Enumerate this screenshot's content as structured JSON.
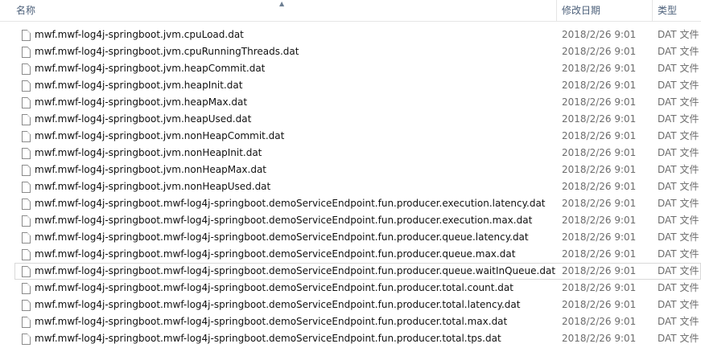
{
  "columns": {
    "name": "名称",
    "date": "修改日期",
    "type": "类型"
  },
  "files": [
    {
      "name": "mwf.mwf-log4j-springboot.jvm.cpuLoad.dat",
      "date": "2018/2/26 9:01",
      "type": "DAT 文件"
    },
    {
      "name": "mwf.mwf-log4j-springboot.jvm.cpuRunningThreads.dat",
      "date": "2018/2/26 9:01",
      "type": "DAT 文件"
    },
    {
      "name": "mwf.mwf-log4j-springboot.jvm.heapCommit.dat",
      "date": "2018/2/26 9:01",
      "type": "DAT 文件"
    },
    {
      "name": "mwf.mwf-log4j-springboot.jvm.heapInit.dat",
      "date": "2018/2/26 9:01",
      "type": "DAT 文件"
    },
    {
      "name": "mwf.mwf-log4j-springboot.jvm.heapMax.dat",
      "date": "2018/2/26 9:01",
      "type": "DAT 文件"
    },
    {
      "name": "mwf.mwf-log4j-springboot.jvm.heapUsed.dat",
      "date": "2018/2/26 9:01",
      "type": "DAT 文件"
    },
    {
      "name": "mwf.mwf-log4j-springboot.jvm.nonHeapCommit.dat",
      "date": "2018/2/26 9:01",
      "type": "DAT 文件"
    },
    {
      "name": "mwf.mwf-log4j-springboot.jvm.nonHeapInit.dat",
      "date": "2018/2/26 9:01",
      "type": "DAT 文件"
    },
    {
      "name": "mwf.mwf-log4j-springboot.jvm.nonHeapMax.dat",
      "date": "2018/2/26 9:01",
      "type": "DAT 文件"
    },
    {
      "name": "mwf.mwf-log4j-springboot.jvm.nonHeapUsed.dat",
      "date": "2018/2/26 9:01",
      "type": "DAT 文件"
    },
    {
      "name": "mwf.mwf-log4j-springboot.mwf-log4j-springboot.demoServiceEndpoint.fun.producer.execution.latency.dat",
      "date": "2018/2/26 9:01",
      "type": "DAT 文件"
    },
    {
      "name": "mwf.mwf-log4j-springboot.mwf-log4j-springboot.demoServiceEndpoint.fun.producer.execution.max.dat",
      "date": "2018/2/26 9:01",
      "type": "DAT 文件"
    },
    {
      "name": "mwf.mwf-log4j-springboot.mwf-log4j-springboot.demoServiceEndpoint.fun.producer.queue.latency.dat",
      "date": "2018/2/26 9:01",
      "type": "DAT 文件"
    },
    {
      "name": "mwf.mwf-log4j-springboot.mwf-log4j-springboot.demoServiceEndpoint.fun.producer.queue.max.dat",
      "date": "2018/2/26 9:01",
      "type": "DAT 文件"
    },
    {
      "name": "mwf.mwf-log4j-springboot.mwf-log4j-springboot.demoServiceEndpoint.fun.producer.queue.waitInQueue.dat",
      "date": "2018/2/26 9:01",
      "type": "DAT 文件",
      "focused": true
    },
    {
      "name": "mwf.mwf-log4j-springboot.mwf-log4j-springboot.demoServiceEndpoint.fun.producer.total.count.dat",
      "date": "2018/2/26 9:01",
      "type": "DAT 文件"
    },
    {
      "name": "mwf.mwf-log4j-springboot.mwf-log4j-springboot.demoServiceEndpoint.fun.producer.total.latency.dat",
      "date": "2018/2/26 9:01",
      "type": "DAT 文件"
    },
    {
      "name": "mwf.mwf-log4j-springboot.mwf-log4j-springboot.demoServiceEndpoint.fun.producer.total.max.dat",
      "date": "2018/2/26 9:01",
      "type": "DAT 文件"
    },
    {
      "name": "mwf.mwf-log4j-springboot.mwf-log4j-springboot.demoServiceEndpoint.fun.producer.total.tps.dat",
      "date": "2018/2/26 9:01",
      "type": "DAT 文件"
    }
  ]
}
